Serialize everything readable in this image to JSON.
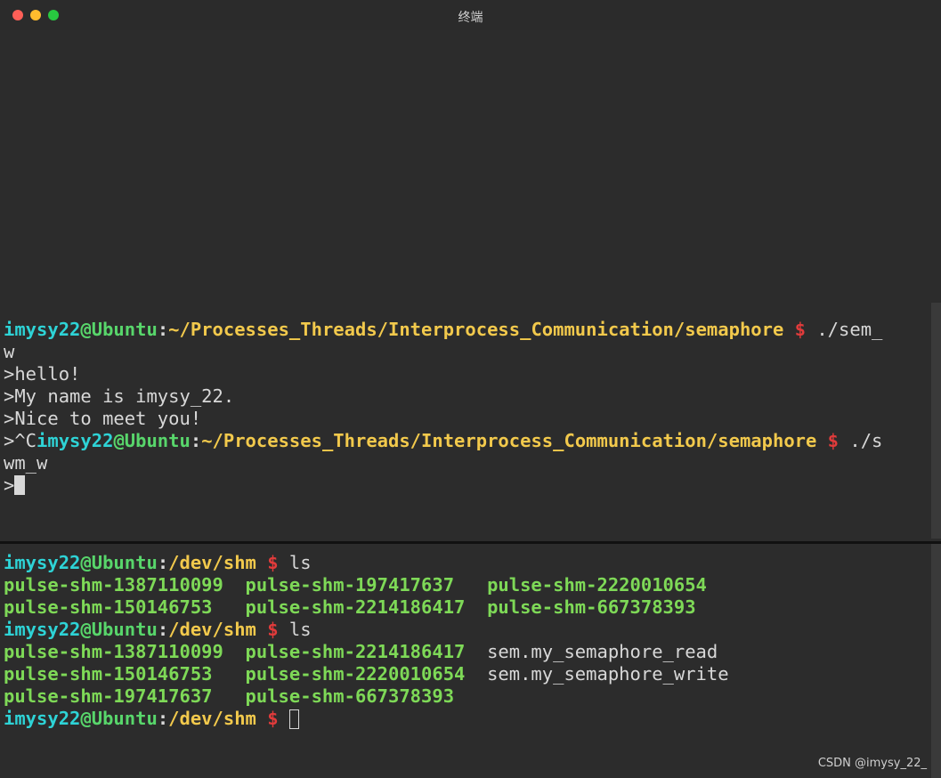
{
  "window": {
    "title": "终端"
  },
  "top_terminal": {
    "line1": {
      "user": "imysy22",
      "at": "@",
      "host": "Ubuntu",
      "colon": ":",
      "path": "~/Processes_Threads/Interprocess_Communication/semaphore",
      "dollar": " $",
      "cmd": " ./sem_"
    },
    "line2": "w",
    "line3": ">hello!",
    "line4": ">My name is imysy_22.",
    "line5": ">Nice to meet you!",
    "line6": {
      "prefix": ">^C",
      "user": "imysy22",
      "at": "@",
      "host": "Ubuntu",
      "colon": ":",
      "path": "~/Processes_Threads/Interprocess_Communication/semaphore",
      "dollar": " $",
      "cmd": " ./s"
    },
    "line7": "wm_w",
    "line8": ">"
  },
  "bottom_terminal": {
    "prompt": {
      "user": "imysy22",
      "at": "@",
      "host": "Ubuntu",
      "colon": ":",
      "path": "/dev/shm",
      "dollar": " $"
    },
    "cmd1": " ls",
    "ls1_row1": [
      "pulse-shm-1387110099",
      "pulse-shm-197417637",
      "pulse-shm-2220010654"
    ],
    "ls1_row2": [
      "pulse-shm-150146753",
      "pulse-shm-2214186417",
      "pulse-shm-667378393"
    ],
    "cmd2": " ls",
    "ls2_row1": [
      "pulse-shm-1387110099",
      "pulse-shm-2214186417",
      "sem.my_semaphore_read"
    ],
    "ls2_row2": [
      "pulse-shm-150146753",
      "pulse-shm-2220010654",
      "sem.my_semaphore_write"
    ],
    "ls2_row3": [
      "pulse-shm-197417637",
      "pulse-shm-667378393"
    ]
  },
  "watermark": "CSDN @imysy_22_",
  "colors": {
    "user": "#2ed3d6",
    "host": "#58d66b",
    "path": "#f2c94c",
    "dollar": "#e23b3b",
    "file": "#7ed957",
    "background": "#2c2c2c"
  }
}
